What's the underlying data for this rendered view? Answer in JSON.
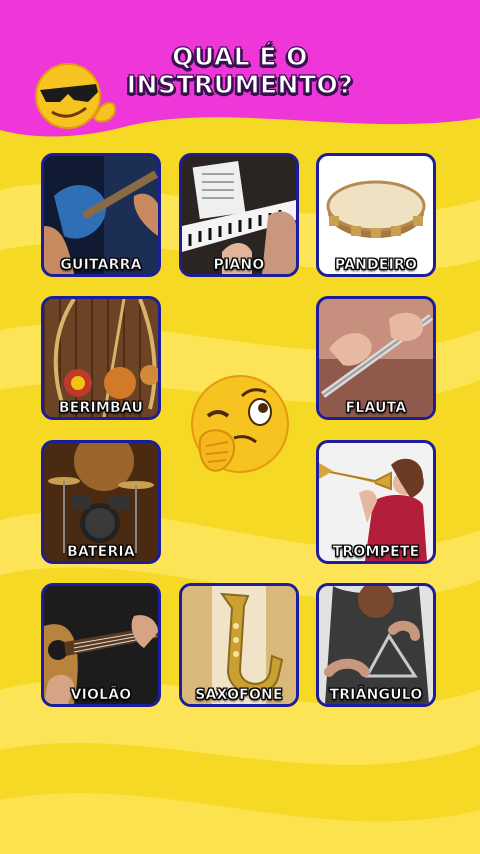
{
  "header": {
    "title_line1": "QUAL É O",
    "title_line2": "INSTRUMENTO?",
    "emoji_icon": "cool-sunglasses-emoji"
  },
  "center_emoji_icon": "thinking-winking-emoji",
  "colors": {
    "top_band": "#ee36d9",
    "background": "#f6d925",
    "wave": "#ffe86b",
    "tile_border": "#1b1d9a"
  },
  "instruments": [
    {
      "name": "GUITARRA",
      "icon": "electric-guitar-photo"
    },
    {
      "name": "PIANO",
      "icon": "piano-photo"
    },
    {
      "name": "PANDEIRO",
      "icon": "tambourine-photo"
    },
    {
      "name": "BERIMBAU",
      "icon": "berimbau-photo"
    },
    {
      "name": "FLAUTA",
      "icon": "flute-photo"
    },
    {
      "name": "BATERIA",
      "icon": "drum-kit-photo"
    },
    {
      "name": "TROMPETE",
      "icon": "trumpet-photo"
    },
    {
      "name": "VIOLÃO",
      "icon": "acoustic-guitar-photo"
    },
    {
      "name": "SAXOFONE",
      "icon": "saxophone-photo"
    },
    {
      "name": "TRIÂNGULO",
      "icon": "triangle-photo"
    }
  ]
}
